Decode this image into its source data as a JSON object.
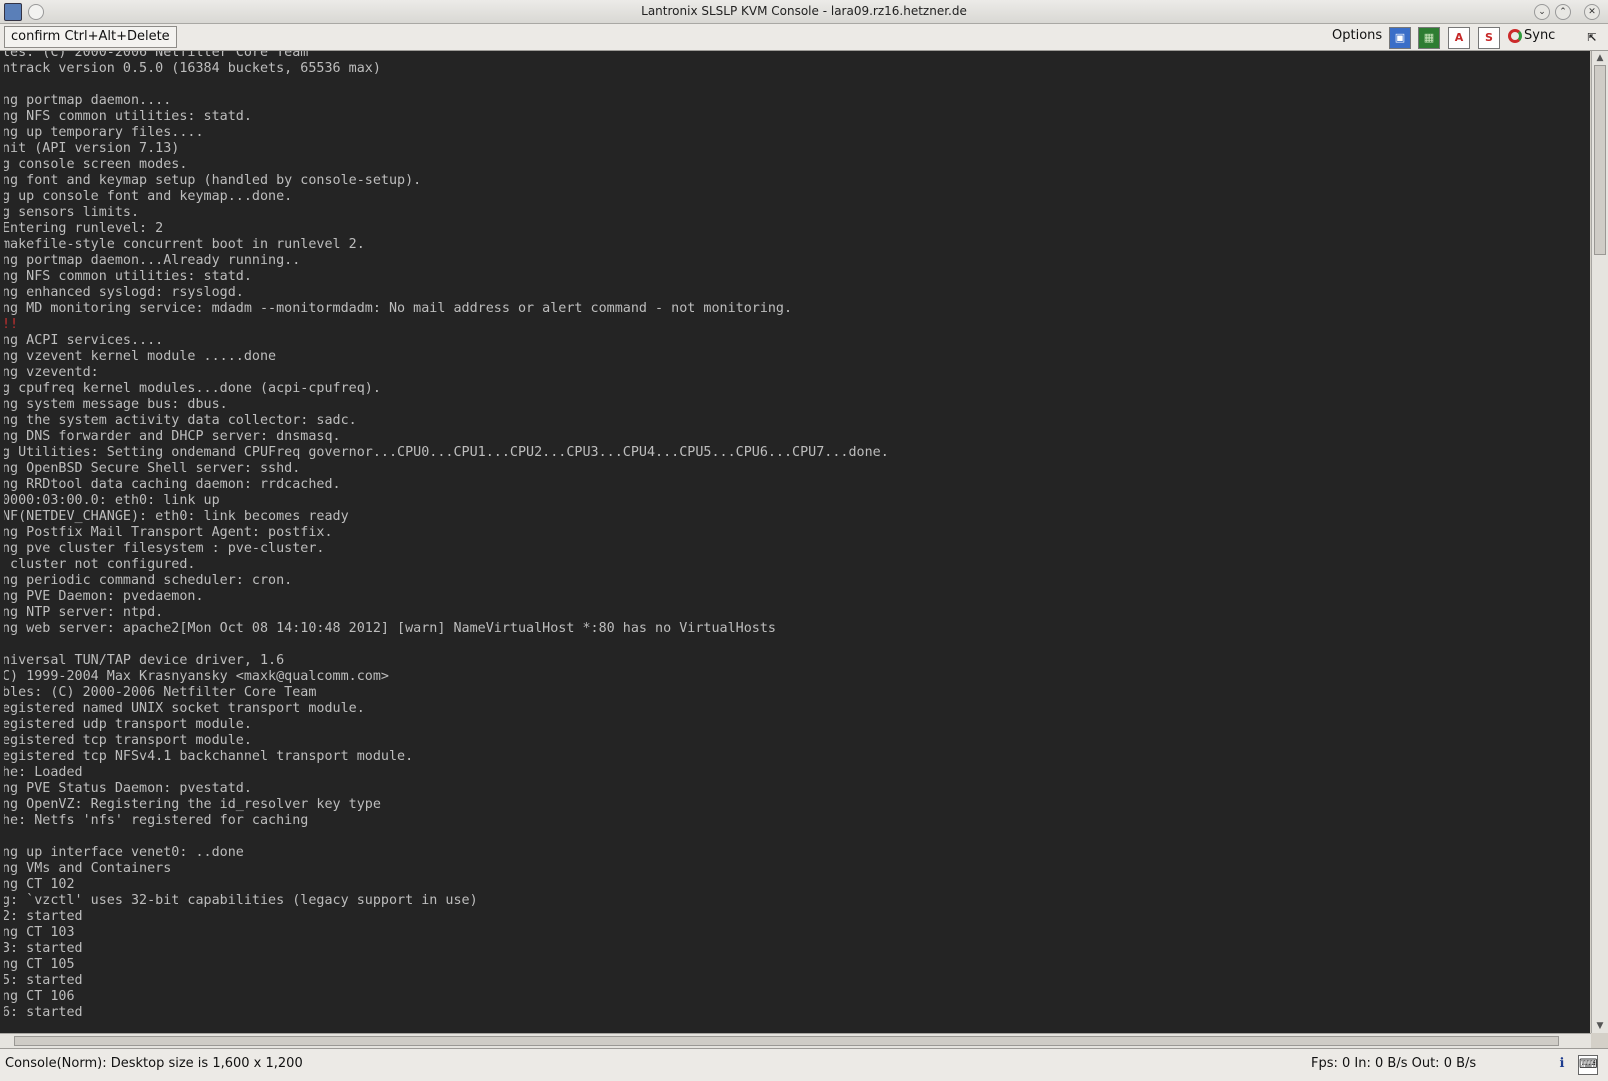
{
  "window": {
    "title": "Lantronix SLSLP KVM Console - lara09.rz16.hetzner.de"
  },
  "toolbar": {
    "cad_button": "confirm Ctrl+Alt+Delete",
    "options_label": "Options",
    "sync_label": "Sync",
    "icons": [
      "save-icon",
      "monitor-icon",
      "autoadjust-icon",
      "scale-icon",
      "sync-icon",
      "mouse-icon"
    ]
  },
  "console": {
    "lines": [
      "les: (C) 2000-2006 Netfilter Core Team",
      "ntrack version 0.5.0 (16384 buckets, 65536 max)",
      "",
      "ng portmap daemon....",
      "ng NFS common utilities: statd.",
      "ng up temporary files....",
      "nit (API version 7.13)",
      "g console screen modes.",
      "ng font and keymap setup (handled by console-setup).",
      "g up console font and keymap...done.",
      "g sensors limits.",
      "Entering runlevel: 2",
      "makefile-style concurrent boot in runlevel 2.",
      "ng portmap daemon...Already running..",
      "ng NFS common utilities: statd.",
      "ng enhanced syslogd: rsyslogd.",
      "ng MD monitoring service: mdadm --monitormdadm: No mail address or alert command - not monitoring.",
      "!!",
      "ng ACPI services....",
      "ng vzevent kernel module .....done",
      "ng vzeventd:",
      "g cpufreq kernel modules...done (acpi-cpufreq).",
      "ng system message bus: dbus.",
      "ng the system activity data collector: sadc.",
      "ng DNS forwarder and DHCP server: dnsmasq.",
      "g Utilities: Setting ondemand CPUFreq governor...CPU0...CPU1...CPU2...CPU3...CPU4...CPU5...CPU6...CPU7...done.",
      "ng OpenBSD Secure Shell server: sshd.",
      "ng RRDtool data caching daemon: rrdcached.",
      "0000:03:00.0: eth0: link up",
      "NF(NETDEV_CHANGE): eth0: link becomes ready",
      "ng Postfix Mail Transport Agent: postfix.",
      "ng pve cluster filesystem : pve-cluster.",
      " cluster not configured.",
      "ng periodic command scheduler: cron.",
      "ng PVE Daemon: pvedaemon.",
      "ng NTP server: ntpd.",
      "ng web server: apache2[Mon Oct 08 14:10:48 2012] [warn] NameVirtualHost *:80 has no VirtualHosts",
      "",
      "niversal TUN/TAP device driver, 1.6",
      "C) 1999-2004 Max Krasnyansky <maxk@qualcomm.com>",
      "bles: (C) 2000-2006 Netfilter Core Team",
      "egistered named UNIX socket transport module.",
      "egistered udp transport module.",
      "egistered tcp transport module.",
      "egistered tcp NFSv4.1 backchannel transport module.",
      "he: Loaded",
      "ng PVE Status Daemon: pvestatd.",
      "ng OpenVZ: Registering the id_resolver key type",
      "he: Netfs 'nfs' registered for caching",
      "",
      "ng up interface venet0: ..done",
      "ng VMs and Containers",
      "ng CT 102",
      "g: `vzctl' uses 32-bit capabilities (legacy support in use)",
      "2: started",
      "ng CT 103",
      "3: started",
      "ng CT 105",
      "5: started",
      "ng CT 106",
      "6: started"
    ]
  },
  "status": {
    "left": "Console(Norm): Desktop size is 1,600 x 1,200",
    "right": "Fps: 0 In: 0 B/s Out: 0 B/s"
  },
  "colors": {
    "console_bg": "#242424",
    "console_fg": "#bdbdbd",
    "alert": "#c03030"
  }
}
